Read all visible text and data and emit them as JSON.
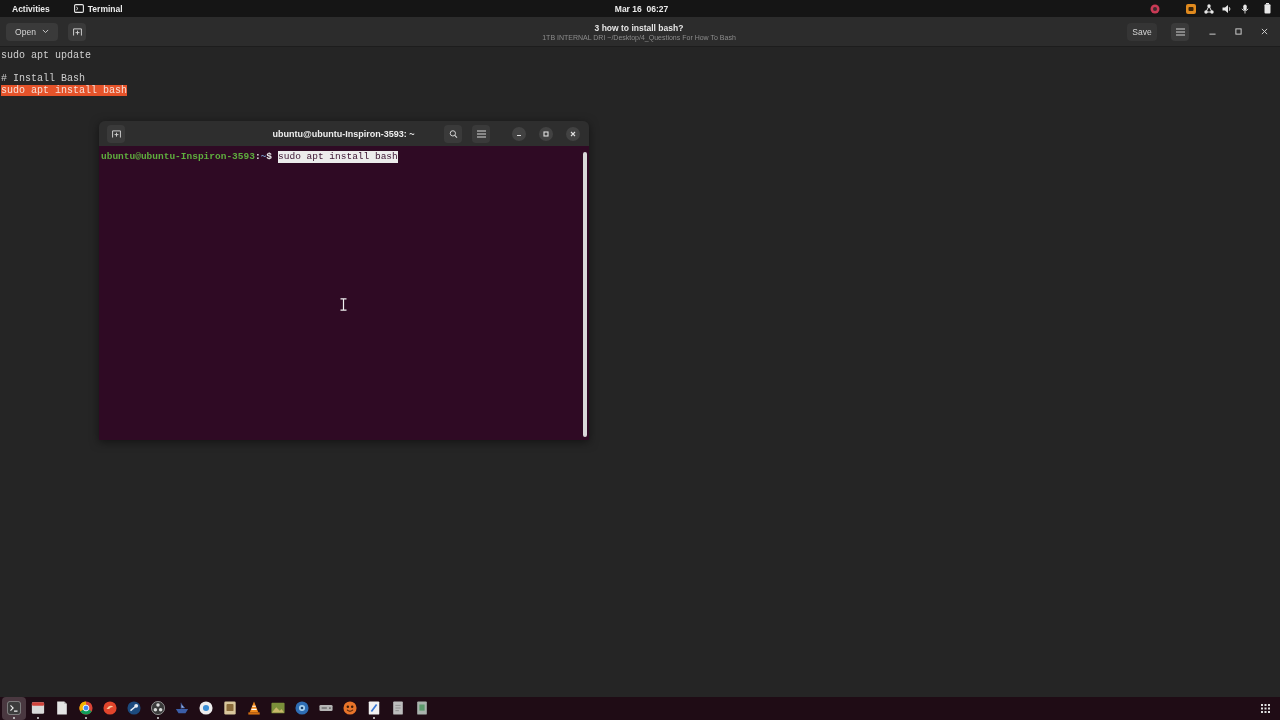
{
  "top_bar": {
    "activities": "Activities",
    "app_menu": "Terminal",
    "clock": "Mar 16  06:27"
  },
  "editor": {
    "header": {
      "open_button": "Open",
      "title": "3 how to install bash?",
      "path": "1TB INTERNAL DRI ~/Desktop/4_Questions For How To Bash",
      "save_button": "Save"
    },
    "paragraphs": [
      {
        "lines": [
          {
            "text": "sudo apt update",
            "highlighted": false
          }
        ]
      },
      {
        "lines": [
          {
            "text": "# Install Bash",
            "highlighted": false
          },
          {
            "text": "sudo apt install bash",
            "highlighted": true
          }
        ]
      }
    ]
  },
  "terminal": {
    "title": "ubuntu@ubuntu-Inspiron-3593: ~",
    "prompt": [
      {
        "kind": "user_host",
        "text": "ubuntu@ubuntu-Inspiron-3593"
      },
      {
        "kind": "plain",
        "text": ":"
      },
      {
        "kind": "path",
        "text": "~"
      },
      {
        "kind": "plain",
        "text": "$"
      }
    ],
    "command": "sudo apt install bash",
    "command_selected": true
  },
  "dock": {
    "apps": [
      {
        "kind": "terminal",
        "selected": true,
        "running": true
      },
      {
        "kind": "window",
        "selected": false,
        "running": true
      },
      {
        "kind": "document",
        "selected": false,
        "running": false
      },
      {
        "kind": "tricolor",
        "selected": false,
        "running": true
      },
      {
        "kind": "orb",
        "selected": false,
        "running": false
      },
      {
        "kind": "knob",
        "selected": false,
        "running": false
      },
      {
        "kind": "aperture",
        "selected": false,
        "running": true
      },
      {
        "kind": "ship",
        "selected": false,
        "running": false
      },
      {
        "kind": "disc",
        "selected": false,
        "running": false
      },
      {
        "kind": "card",
        "selected": false,
        "running": false
      },
      {
        "kind": "cone",
        "selected": false,
        "running": false
      },
      {
        "kind": "picture",
        "selected": false,
        "running": false
      },
      {
        "kind": "lens",
        "selected": false,
        "running": false
      },
      {
        "kind": "drive",
        "selected": false,
        "running": false
      },
      {
        "kind": "face",
        "selected": false,
        "running": false
      },
      {
        "kind": "editor",
        "selected": false,
        "running": true
      },
      {
        "kind": "sheet",
        "selected": false,
        "running": false
      },
      {
        "kind": "note",
        "selected": false,
        "running": false
      }
    ]
  }
}
